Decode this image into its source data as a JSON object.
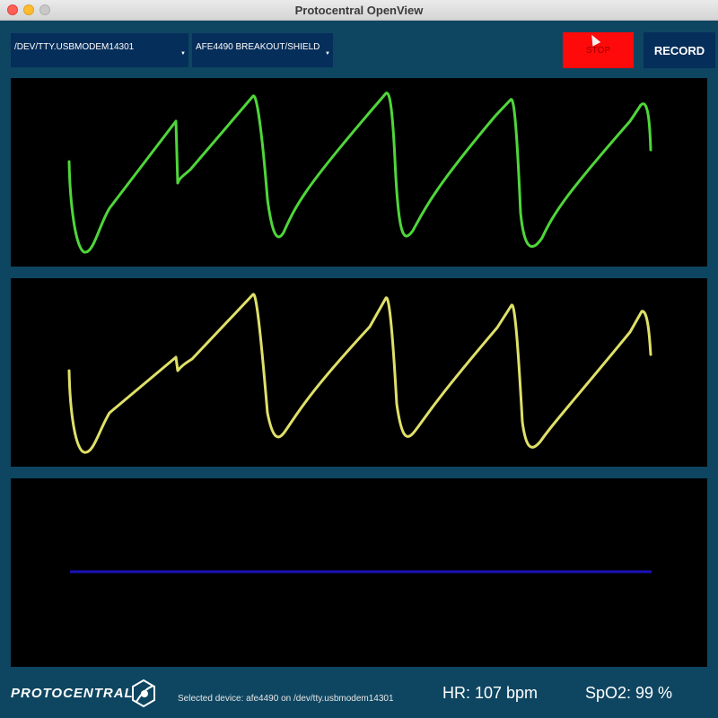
{
  "window": {
    "title": "Protocentral OpenView"
  },
  "toolbar": {
    "port_select": {
      "value": "/DEV/TTY.USBMODEM14301"
    },
    "board_select": {
      "value": "AFE4490 BREAKOUT/SHIELD"
    },
    "stop_label": "STOP",
    "record_label": "RECORD",
    "stop_color": "#ff0a0a",
    "dropdown_color": "#062e5a"
  },
  "plots": {
    "ppg_ir": {
      "color": "#4fd63a",
      "waveform": "sawtooth-pulse"
    },
    "ppg_red": {
      "color": "#dfe068",
      "waveform": "sawtooth-pulse"
    },
    "third": {
      "color": "#1a12b8",
      "waveform": "flat"
    }
  },
  "footer": {
    "logo_text": "PROTOCENTRAL",
    "selected_device": "Selected device: afe4490 on /dev/tty.usbmodem14301",
    "hr": "HR: 107 bpm",
    "spo2": "SpO2: 99 %"
  },
  "colors": {
    "background": "#0e4661",
    "panel": "#000000"
  }
}
